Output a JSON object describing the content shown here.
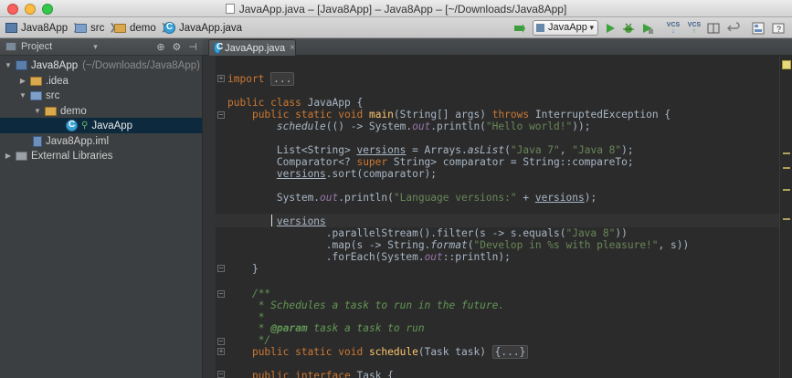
{
  "window": {
    "title": "JavaApp.java – [Java8App] – Java8App – [~/Downloads/Java8App]"
  },
  "breadcrumbs": [
    {
      "label": "Java8App"
    },
    {
      "label": "src"
    },
    {
      "label": "demo"
    },
    {
      "label": "JavaApp.java"
    }
  ],
  "toolbar": {
    "run_config": "JavaApp",
    "vcs_label": "VCS"
  },
  "project_panel": {
    "title": "Project",
    "tools": [
      "⊕",
      "⚙",
      "⊣"
    ]
  },
  "editor_tab": {
    "label": "JavaApp.java",
    "close": "×"
  },
  "tree": [
    {
      "label": "Java8App",
      "path": "(~/Downloads/Java8App)",
      "twisty": "▼"
    },
    {
      "label": ".idea",
      "twisty": "▶"
    },
    {
      "label": "src",
      "twisty": "▼"
    },
    {
      "label": "demo",
      "twisty": "▼"
    },
    {
      "label": "JavaApp"
    },
    {
      "label": "Java8App.iml"
    },
    {
      "label": "External Libraries",
      "twisty": "▶"
    }
  ],
  "code": {
    "import_kw": "import",
    "import_fold": "...",
    "class_decl_kw": "public class",
    "class_name": "JavaApp {",
    "main_kw": "public static void",
    "main_name": "main",
    "main_args": "(String[] args)",
    "throws_kw": "throws",
    "main_exc": "InterruptedException {",
    "sched_name": "schedule",
    "sched_mid": "(() -> System.",
    "out": "out",
    "println_hello": ".println(",
    "hello_str": "\"Hello world!\"",
    "sched_end": "));",
    "list_decl": "List<String> ",
    "versions": "versions",
    "list_eq": " = Arrays.",
    "aslist": "asList",
    "list_paren": "(",
    "java7": "\"Java 7\"",
    "comma": ", ",
    "java8": "\"Java 8\"",
    "list_end": ");",
    "comp_start": "Comparator<? ",
    "super_kw": "super",
    "comp_end": " String> comparator = String::compareTo;",
    "sort_call": ".sort(comparator);",
    "sysout_start": "System.",
    "println_open": ".println(",
    "lang_str": "\"Language versions:\"",
    "plus": " + ",
    "sysout_end": ");",
    "stream_line": ".parallelStream().filter(s -> s.equals(",
    "java8b": "\"Java 8\"",
    "stream_end": "))",
    "map_start": ".map(s -> String.",
    "format_fn": "format",
    "map_paren": "(",
    "develop_str": "\"Develop in %s with pleasure!\"",
    "map_end": ", s))",
    "foreach_start": ".forEach(System.",
    "foreach_end": "::println);",
    "close_brace": "}",
    "doc_open": "/**",
    "doc_line1": " * Schedules a task to run in the future.",
    "doc_star": " *",
    "doc_param_tag": "@param",
    "doc_param_rest": " task a task to run",
    "doc_close": " */",
    "sched_decl_kw": "public static void",
    "sched_decl_name": "schedule",
    "sched_decl_args": "(Task task) ",
    "sched_fold": "{...}",
    "iface_kw": "public interface",
    "iface_name": "Task {"
  }
}
